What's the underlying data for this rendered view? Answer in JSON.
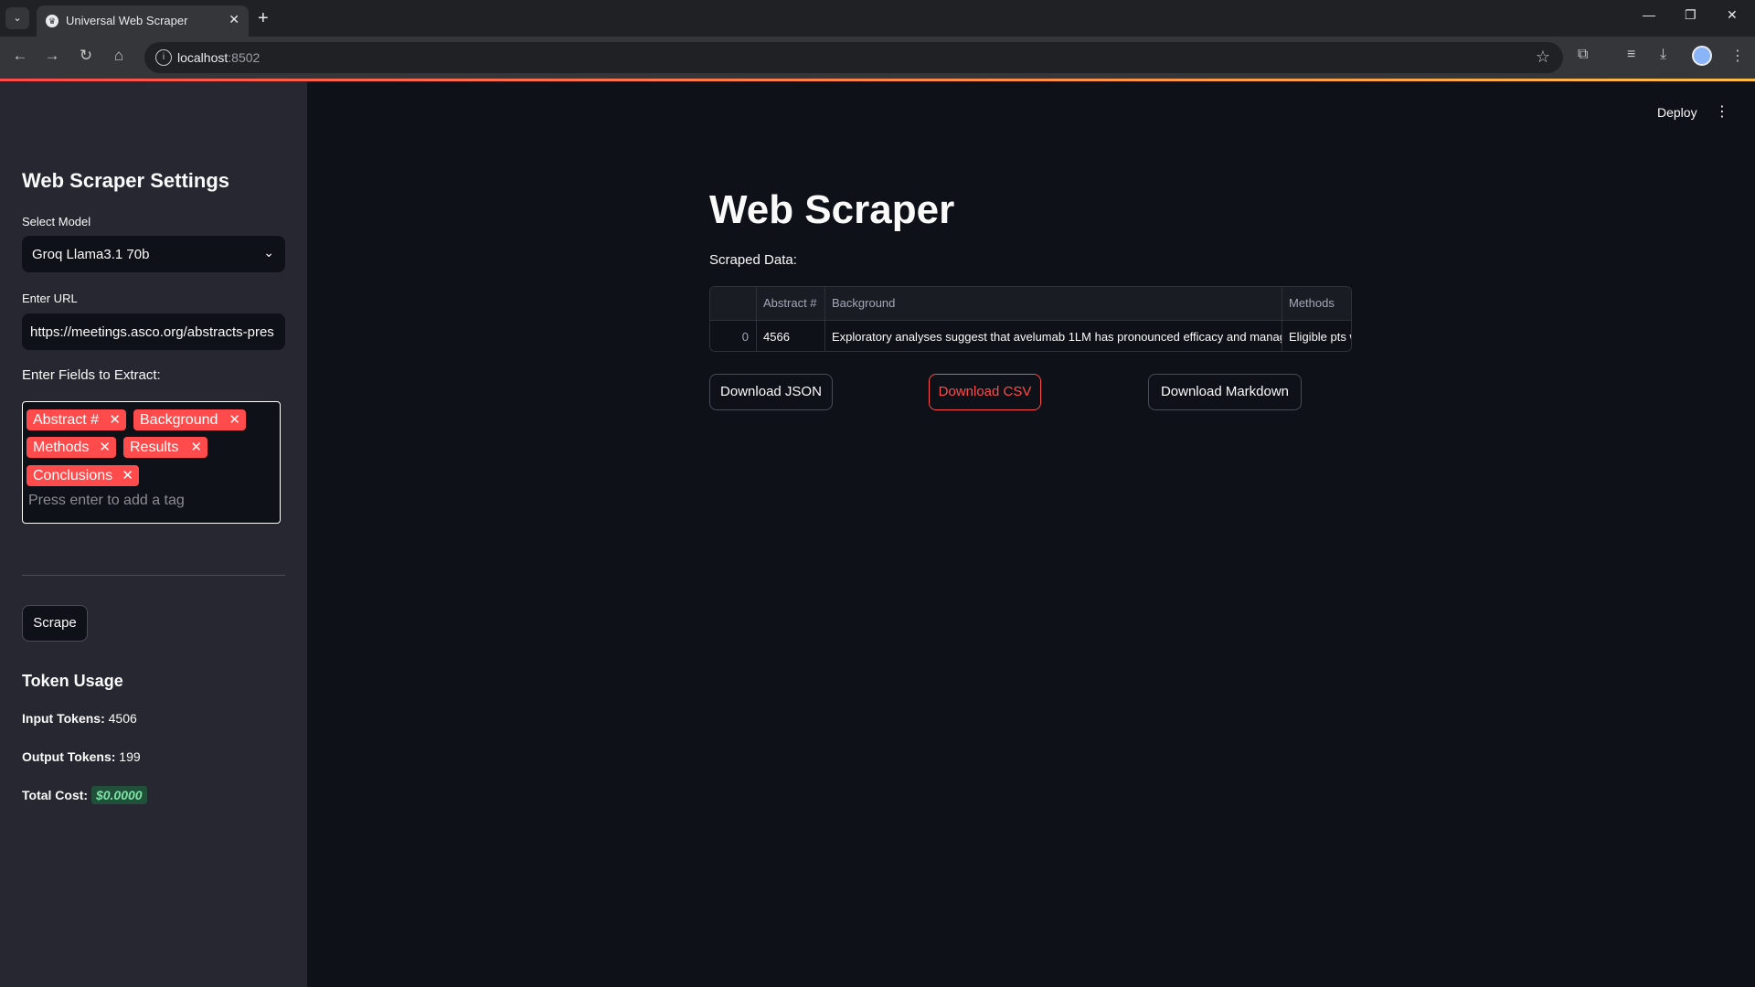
{
  "browser": {
    "tab_title": "Universal Web Scraper",
    "url_host": "localhost",
    "url_port": ":8502"
  },
  "sidebar": {
    "title": "Web Scraper Settings",
    "model_label": "Select Model",
    "model_value": "Groq Llama3.1 70b",
    "url_label": "Enter URL",
    "url_value": "https://meetings.asco.org/abstracts-pres",
    "fields_label": "Enter Fields to Extract:",
    "tags": [
      "Abstract #",
      "Background",
      "Methods",
      "Results",
      "Conclusions"
    ],
    "tag_placeholder": "Press enter to add a tag",
    "scrape_label": "Scrape",
    "token_title": "Token Usage",
    "input_tokens_label": "Input Tokens:",
    "input_tokens": "4506",
    "output_tokens_label": "Output Tokens:",
    "output_tokens": "199",
    "total_cost_label": "Total Cost:",
    "total_cost": "$0.0000"
  },
  "header": {
    "deploy_label": "Deploy"
  },
  "main": {
    "title": "Web Scraper",
    "scraped_label": "Scraped Data:",
    "table": {
      "columns": [
        "",
        "Abstract #",
        "Background",
        "Methods"
      ],
      "rows": [
        [
          "0",
          "4566",
          "Exploratory analyses suggest that avelumab 1LM has pronounced efficacy and manag",
          "Eligible pts w"
        ]
      ]
    },
    "buttons": {
      "json": "Download JSON",
      "csv": "Download CSV",
      "markdown": "Download Markdown"
    }
  },
  "colors": {
    "accent": "#ff4b4b",
    "background": "#0e1117",
    "sidebar": "#262730"
  }
}
